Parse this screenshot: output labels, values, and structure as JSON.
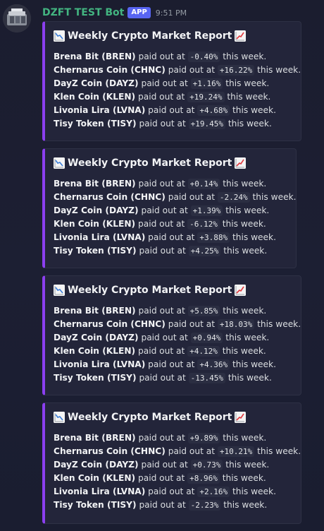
{
  "bot": {
    "username": "DZFT TEST Bot",
    "badge": "APP",
    "timestamp": "9:51 PM"
  },
  "icons": {
    "chart_down": "chart-decreasing-emoji",
    "chart_up": "chart-increasing-emoji"
  },
  "colors": {
    "embed_accent": "#8b3ff0",
    "username": "#43b581",
    "badge": "#5865f2"
  },
  "text": {
    "paid_out_at": "paid out at",
    "this_week": "this week."
  },
  "reports": [
    {
      "title": "Weekly Crypto Market Report",
      "lines": [
        {
          "coin": "Brena Bit (BREN)",
          "value": "-0.40%"
        },
        {
          "coin": "Chernarus Coin (CHNC)",
          "value": "+16.22%"
        },
        {
          "coin": "DayZ Coin (DAYZ)",
          "value": "+1.16%"
        },
        {
          "coin": "Klen Coin (KLEN)",
          "value": "+19.24%"
        },
        {
          "coin": "Livonia Lira (LVNA)",
          "value": "+4.68%"
        },
        {
          "coin": "Tisy Token (TISY)",
          "value": "+19.45%"
        }
      ]
    },
    {
      "title": "Weekly Crypto Market Report",
      "lines": [
        {
          "coin": "Brena Bit (BREN)",
          "value": "+0.14%"
        },
        {
          "coin": "Chernarus Coin (CHNC)",
          "value": "-2.24%"
        },
        {
          "coin": "DayZ Coin (DAYZ)",
          "value": "+1.39%"
        },
        {
          "coin": "Klen Coin (KLEN)",
          "value": "-6.12%"
        },
        {
          "coin": "Livonia Lira (LVNA)",
          "value": "+3.88%"
        },
        {
          "coin": "Tisy Token (TISY)",
          "value": "+4.25%"
        }
      ]
    },
    {
      "title": "Weekly Crypto Market Report",
      "lines": [
        {
          "coin": "Brena Bit (BREN)",
          "value": "+5.85%"
        },
        {
          "coin": "Chernarus Coin (CHNC)",
          "value": "+18.03%"
        },
        {
          "coin": "DayZ Coin (DAYZ)",
          "value": "+0.94%"
        },
        {
          "coin": "Klen Coin (KLEN)",
          "value": "+4.12%"
        },
        {
          "coin": "Livonia Lira (LVNA)",
          "value": "+4.36%"
        },
        {
          "coin": "Tisy Token (TISY)",
          "value": "-13.45%"
        }
      ]
    },
    {
      "title": "Weekly Crypto Market Report",
      "lines": [
        {
          "coin": "Brena Bit (BREN)",
          "value": "+9.89%"
        },
        {
          "coin": "Chernarus Coin (CHNC)",
          "value": "+10.21%"
        },
        {
          "coin": "DayZ Coin (DAYZ)",
          "value": "+0.73%"
        },
        {
          "coin": "Klen Coin (KLEN)",
          "value": "+8.96%"
        },
        {
          "coin": "Livonia Lira (LVNA)",
          "value": "+2.16%"
        },
        {
          "coin": "Tisy Token (TISY)",
          "value": "-2.23%"
        }
      ]
    }
  ]
}
